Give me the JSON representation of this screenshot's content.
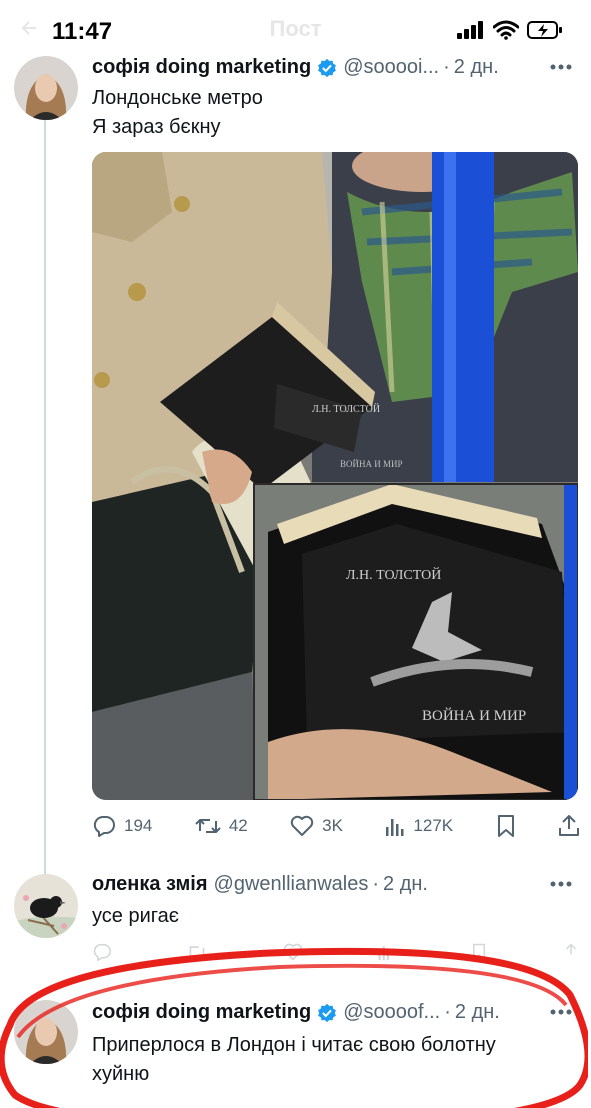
{
  "status_bar": {
    "time": "11:47"
  },
  "header": {
    "title": "Пост"
  },
  "main_tweet": {
    "display_name": "софія doing marketing",
    "handle": "@sooooi...",
    "date": "2 дн.",
    "lines": [
      "Лондонське метро",
      "Я зараз бєкну"
    ],
    "book": {
      "author": "Л.Н. ТОЛСТОЙ",
      "title": "ВОЙНА И МИР"
    },
    "stats": {
      "replies": "194",
      "reposts": "42",
      "likes": "3K",
      "views": "127K"
    }
  },
  "reply_1": {
    "display_name": "оленка змія",
    "handle": "@gwenllianwales",
    "date": "2 дн.",
    "text": "усе ригає"
  },
  "reply_2": {
    "display_name": "софія doing marketing",
    "handle": "@soooof...",
    "date": "2 дн.",
    "text_line1": "Приперлося в Лондон і читає свою болотну",
    "text_line2": "хуйню"
  },
  "colors": {
    "accent": "#1d9bf0",
    "annotation": "#e8201a",
    "pole": "#1a4fd6"
  }
}
